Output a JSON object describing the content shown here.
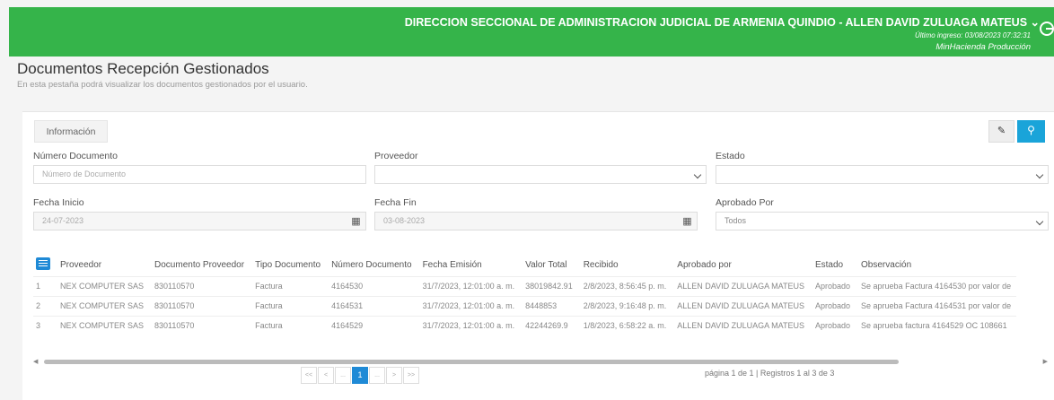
{
  "header": {
    "title": "DIRECCION SECCIONAL DE ADMINISTRACION JUDICIAL DE ARMENIA QUINDIO - ALLEN DAVID ZULUAGA MATEUS ⌄",
    "last_login": "Último ingreso: 03/08/2023 07:32:31",
    "environment": "MinHacienda Producción",
    "accent": "#35b44a"
  },
  "page": {
    "title": "Documentos Recepción Gestionados",
    "subtitle": "En esta pestaña podrá visualizar los documentos gestionados por el usuario."
  },
  "tab": {
    "label": "Información"
  },
  "filters": {
    "numero_documento": {
      "label": "Número Documento",
      "placeholder": "Número de Documento"
    },
    "proveedor": {
      "label": "Proveedor",
      "value": ""
    },
    "estado": {
      "label": "Estado",
      "value": ""
    },
    "fecha_inicio": {
      "label": "Fecha Inicio",
      "value": "24-07-2023"
    },
    "fecha_fin": {
      "label": "Fecha Fin",
      "value": "03-08-2023"
    },
    "aprobado_por": {
      "label": "Aprobado Por",
      "value": "Todos"
    }
  },
  "table": {
    "headers": [
      "Proveedor",
      "Documento Proveedor",
      "Tipo Documento",
      "Número Documento",
      "Fecha Emisión",
      "Valor Total",
      "Recibido",
      "Aprobado por",
      "Estado",
      "Observación"
    ],
    "rows": [
      {
        "n": "1",
        "proveedor": "NEX COMPUTER SAS",
        "doc_prov": "830110570",
        "tipo": "Factura",
        "numero": "4164530",
        "fecha": "31/7/2023, 12:01:00 a. m.",
        "valor": "38019842.91",
        "recibido": "2/8/2023, 8:56:45 p. m.",
        "aprobado": "ALLEN DAVID ZULUAGA MATEUS",
        "estado": "Aprobado",
        "obs": "Se aprueba Factura 4164530 por valor de"
      },
      {
        "n": "2",
        "proveedor": "NEX COMPUTER SAS",
        "doc_prov": "830110570",
        "tipo": "Factura",
        "numero": "4164531",
        "fecha": "31/7/2023, 12:01:00 a. m.",
        "valor": "8448853",
        "recibido": "2/8/2023, 9:16:48 p. m.",
        "aprobado": "ALLEN DAVID ZULUAGA MATEUS",
        "estado": "Aprobado",
        "obs": "Se aprueba Factura 4164531 por valor de"
      },
      {
        "n": "3",
        "proveedor": "NEX COMPUTER SAS",
        "doc_prov": "830110570",
        "tipo": "Factura",
        "numero": "4164529",
        "fecha": "31/7/2023, 12:01:00 a. m.",
        "valor": "42244269.9",
        "recibido": "1/8/2023, 6:58:22 a. m.",
        "aprobado": "ALLEN DAVID ZULUAGA MATEUS",
        "estado": "Aprobado",
        "obs": "Se aprueba factura 4164529 OC 108661"
      }
    ]
  },
  "pagination": {
    "first": "<<",
    "prev": "<",
    "ellipsis_left": "...",
    "current": "1",
    "ellipsis_right": "...",
    "next": ">",
    "last": ">>",
    "info": "página 1 de 1 | Registros 1 al 3 de 3"
  }
}
